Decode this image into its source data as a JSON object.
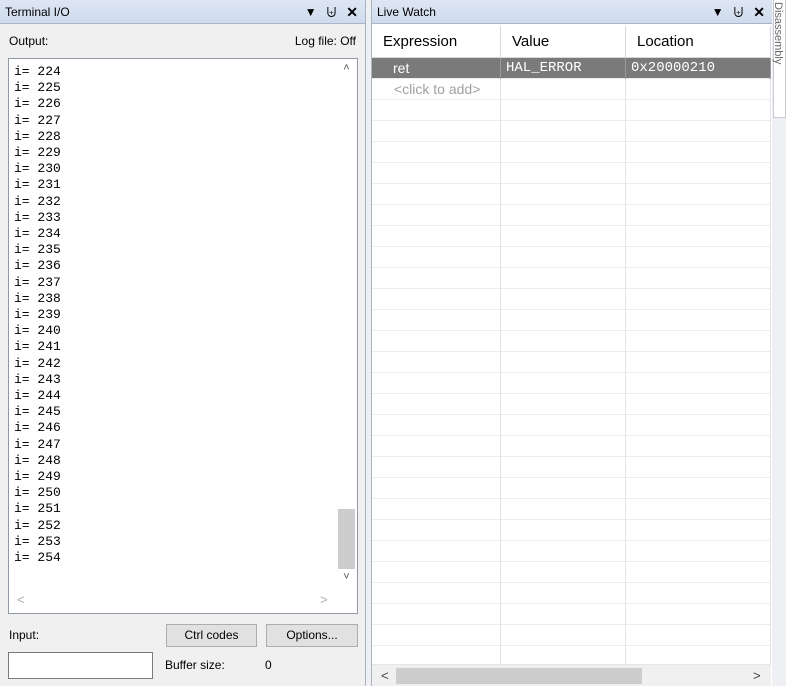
{
  "terminal": {
    "title": "Terminal I/O",
    "output_label": "Output:",
    "logfile_label": "Log file: Off",
    "lines": [
      "i= 224",
      "i= 225",
      "i= 226",
      "i= 227",
      "i= 228",
      "i= 229",
      "i= 230",
      "i= 231",
      "i= 232",
      "i= 233",
      "i= 234",
      "i= 235",
      "i= 236",
      "i= 237",
      "i= 238",
      "i= 239",
      "i= 240",
      "i= 241",
      "i= 242",
      "i= 243",
      "i= 244",
      "i= 245",
      "i= 246",
      "i= 247",
      "i= 248",
      "i= 249",
      "i= 250",
      "i= 251",
      "i= 252",
      "i= 253",
      "i= 254"
    ],
    "input_label": "Input:",
    "input_value": "",
    "ctrl_codes_label": "Ctrl codes",
    "options_label": "Options...",
    "buffer_size_label": "Buffer size:",
    "buffer_size_value": "0"
  },
  "watch": {
    "title": "Live Watch",
    "columns": [
      "Expression",
      "Value",
      "Location"
    ],
    "rows": [
      {
        "expression": "ret",
        "value": "HAL_ERROR",
        "location": "0x20000210"
      }
    ],
    "add_placeholder": "<click to add>"
  },
  "side_tab": "Disassembly",
  "icons": {
    "dropdown": "▼",
    "pin": "ᵽ",
    "close": "✕",
    "scroll_up": "^",
    "scroll_down": "v",
    "scroll_left": "<",
    "scroll_right": ">"
  }
}
